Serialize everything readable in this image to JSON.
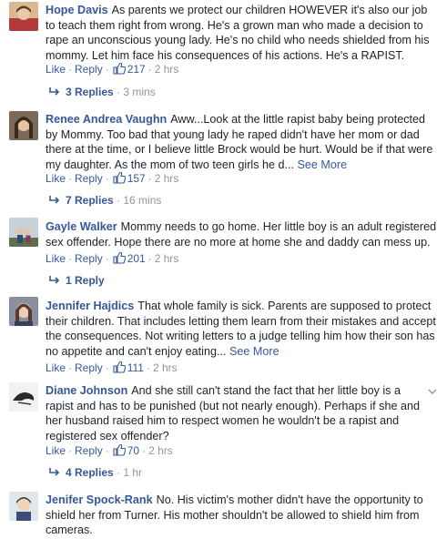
{
  "actions": {
    "like": "Like",
    "reply": "Reply",
    "sep": "·"
  },
  "comments": [
    {
      "author": "Hope Davis",
      "text": "As parents we protect our children HOWEVER it's also our job to teach them right from wrong. He's a grown man who made a decision to rape an unconscious young lady. He's no child who needs shielded from his mommy. Let him face his consequences of his actions. He's a RAPIST.",
      "see_more": "",
      "likes": "217",
      "time": "2 hrs",
      "replies": "3 Replies",
      "replies_time": "3 mins"
    },
    {
      "author": "Renee Andrea Vaughn",
      "text": "Aww...Look at the little rapist baby being protected by Mommy. Too bad that young lady he raped didn't have her mom or dad there at the time, or I believe little Brock would be hurt. Would be if that were my daughter. As the mom of two teen girls he d...",
      "see_more": "See More",
      "likes": "157",
      "time": "2 hrs",
      "replies": "7 Replies",
      "replies_time": "16 mins"
    },
    {
      "author": "Gayle Walker",
      "text": "Mommy needs to go home. Her little boy is an adult registered sex offender. Hope there are no more at home she and daddy can mess up.",
      "see_more": "",
      "likes": "201",
      "time": "2 hrs",
      "replies": "1 Reply",
      "replies_time": ""
    },
    {
      "author": "Jennifer Hajdics",
      "text": "That whole family is sick. Parents are supposed to protect their children. That includes letting them learn from their mistakes and accept the consequences. Not writing letters to a judge telling him how their son has no appetite and can't enjoy eating...",
      "see_more": "See More",
      "likes": "111",
      "time": "2 hrs",
      "replies": "",
      "replies_time": ""
    },
    {
      "author": "Diane Johnson",
      "text": "And she still can't stand the fact that her little boy is a rapist and has to be punished (but not nearly enough). Perhaps if she and her husband raised him to respect women he wouldn't be a rapist and registered sex offender?",
      "see_more": "",
      "likes": "70",
      "time": "2 hrs",
      "replies": "4 Replies",
      "replies_time": "1 hr"
    },
    {
      "author": "Jenifer Spock-Rank",
      "text": "No. His victim's mother didn't have the opportunity to shield her from Turner. His mother shouldn't be allowed to shield him from cameras.",
      "see_more": "",
      "likes": "",
      "time": "",
      "replies": "",
      "replies_time": ""
    }
  ]
}
